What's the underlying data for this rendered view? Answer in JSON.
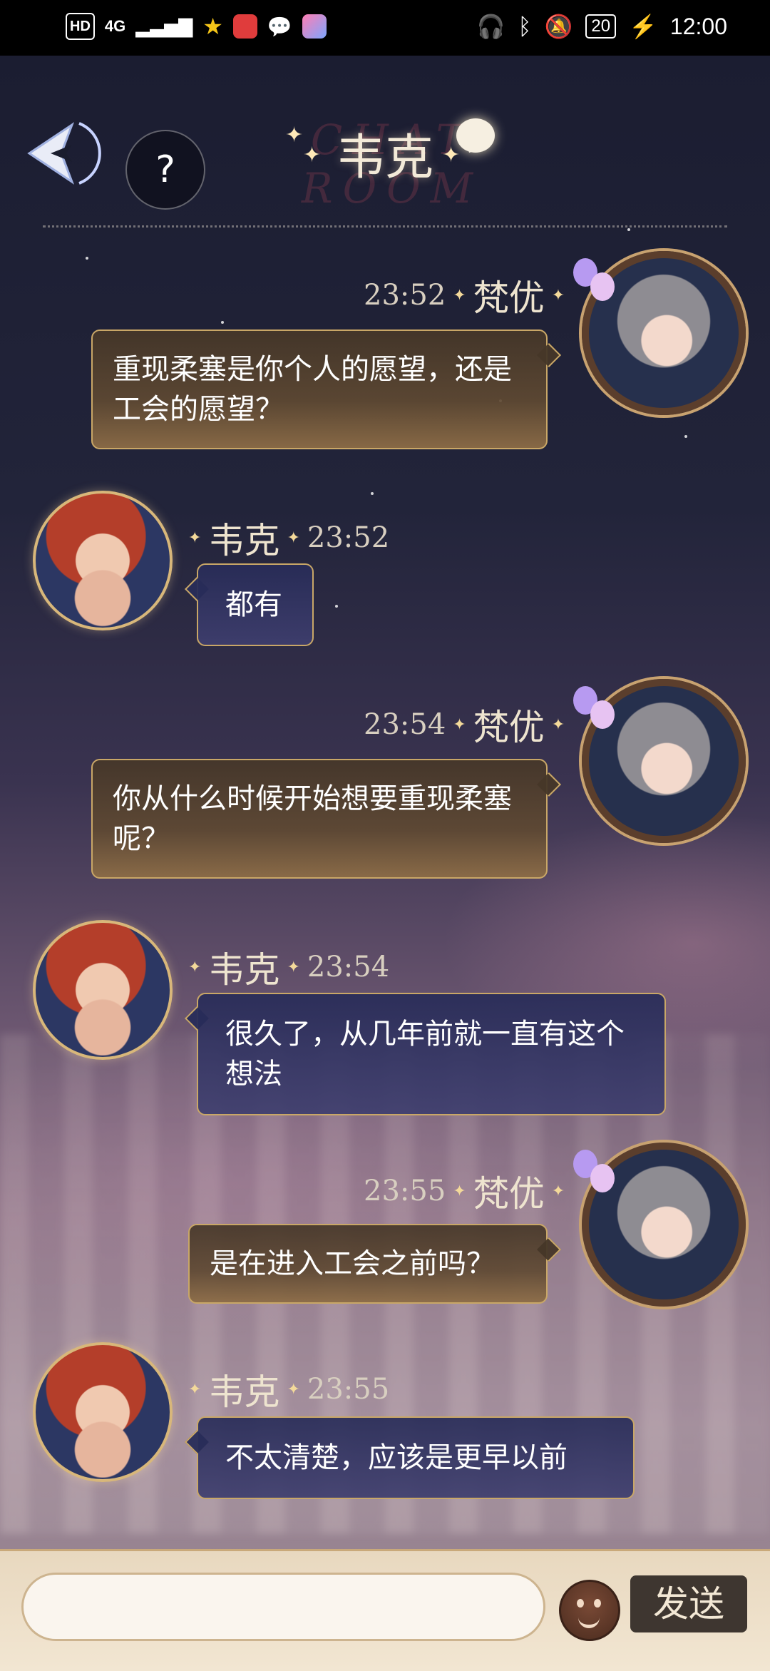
{
  "status_bar": {
    "left_chip": "HD",
    "network": "4G",
    "battery": "20",
    "time": "12:00"
  },
  "header": {
    "title": "韦克",
    "background_text": "CHAT ROOM",
    "help_label": "?"
  },
  "messages": [
    {
      "sender": "梵优",
      "time": "23:52",
      "side": "right",
      "text": "重现柔塞是你个人的愿望，还是工会的愿望？"
    },
    {
      "sender": "韦克",
      "time": "23:52",
      "side": "left",
      "text": "都有"
    },
    {
      "sender": "梵优",
      "time": "23:54",
      "side": "right",
      "text": "你从什么时候开始想要重现柔塞呢？"
    },
    {
      "sender": "韦克",
      "time": "23:54",
      "side": "left",
      "text": "很久了，从几年前就一直有这个想法"
    },
    {
      "sender": "梵优",
      "time": "23:55",
      "side": "right",
      "text": "是在进入工会之前吗？"
    },
    {
      "sender": "韦克",
      "time": "23:55",
      "side": "left",
      "text": "不太清楚，应该是更早以前"
    }
  ],
  "input": {
    "value": "",
    "send_label": "发送"
  },
  "colors": {
    "accent_gold": "#c9a767",
    "bubble_gold": "#5f4932",
    "bubble_blue": "#2c2c58",
    "send_button": "#3e3630"
  },
  "icons": [
    "back-arrow-icon",
    "help-icon",
    "chat-bubble-icon",
    "emoji-icon"
  ]
}
